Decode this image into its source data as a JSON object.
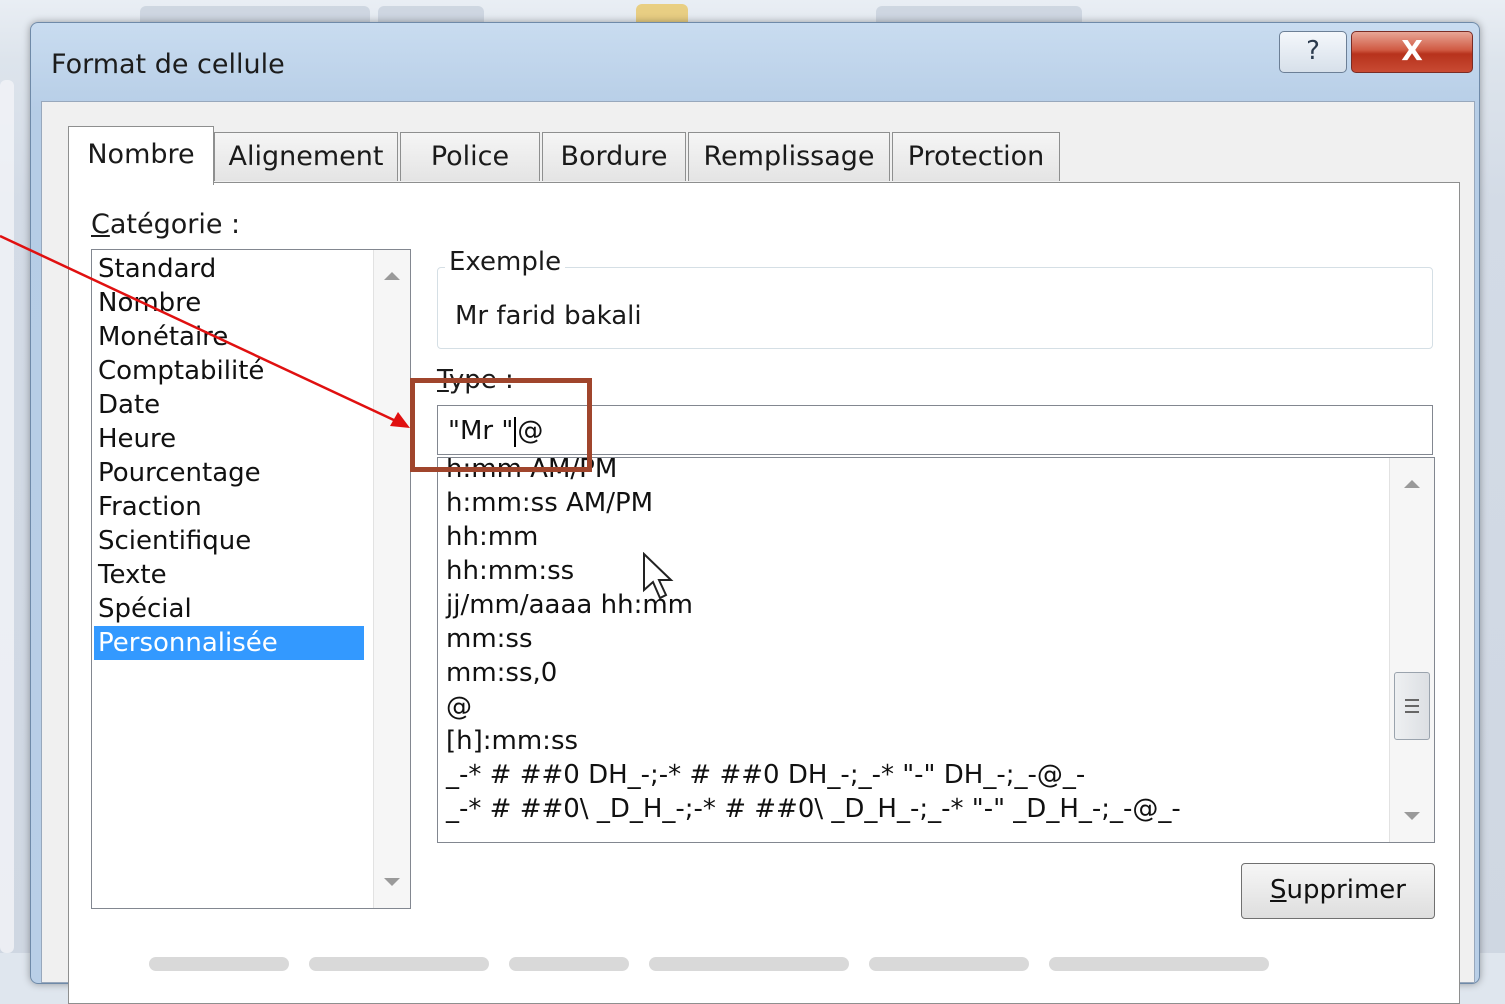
{
  "dialog": {
    "title": "Format de cellule",
    "help_icon": "?",
    "close_icon": "X"
  },
  "tabs": [
    {
      "label": "Nombre",
      "active": true
    },
    {
      "label": "Alignement",
      "active": false
    },
    {
      "label": "Police",
      "active": false
    },
    {
      "label": "Bordure",
      "active": false
    },
    {
      "label": "Remplissage",
      "active": false
    },
    {
      "label": "Protection",
      "active": false
    }
  ],
  "category": {
    "label_first": "C",
    "label_rest": "atégorie :",
    "items": [
      "Standard",
      "Nombre",
      "Monétaire",
      "Comptabilité",
      "Date",
      "Heure",
      "Pourcentage",
      "Fraction",
      "Scientifique",
      "Texte",
      "Spécial",
      "Personnalisée"
    ],
    "selected": "Personnalisée"
  },
  "example": {
    "title": "Exemple",
    "value": "Mr farid bakali"
  },
  "type": {
    "label_first": "T",
    "label_rest": "ype :",
    "value_before_caret": "\"Mr \"",
    "value_after_caret": "@"
  },
  "formats": [
    "h:mm AM/PM",
    "h:mm:ss AM/PM",
    "hh:mm",
    "hh:mm:ss",
    "jj/mm/aaaa hh:mm",
    "mm:ss",
    "mm:ss,0",
    "@",
    "[h]:mm:ss",
    "_-* # ##0 DH_-;-* # ##0 DH_-;_-* \"-\" DH_-;_-@_-",
    "_-* # ##0\\ _D_H_-;-* # ##0\\ _D_H_-;_-* \"-\" _D_H_-;_-@_-"
  ],
  "buttons": {
    "delete_first": "S",
    "delete_rest": "upprimer"
  },
  "colors": {
    "selection": "#3399ff",
    "annotation_box": "#a0452c",
    "annotation_arrow": "#e01010"
  }
}
